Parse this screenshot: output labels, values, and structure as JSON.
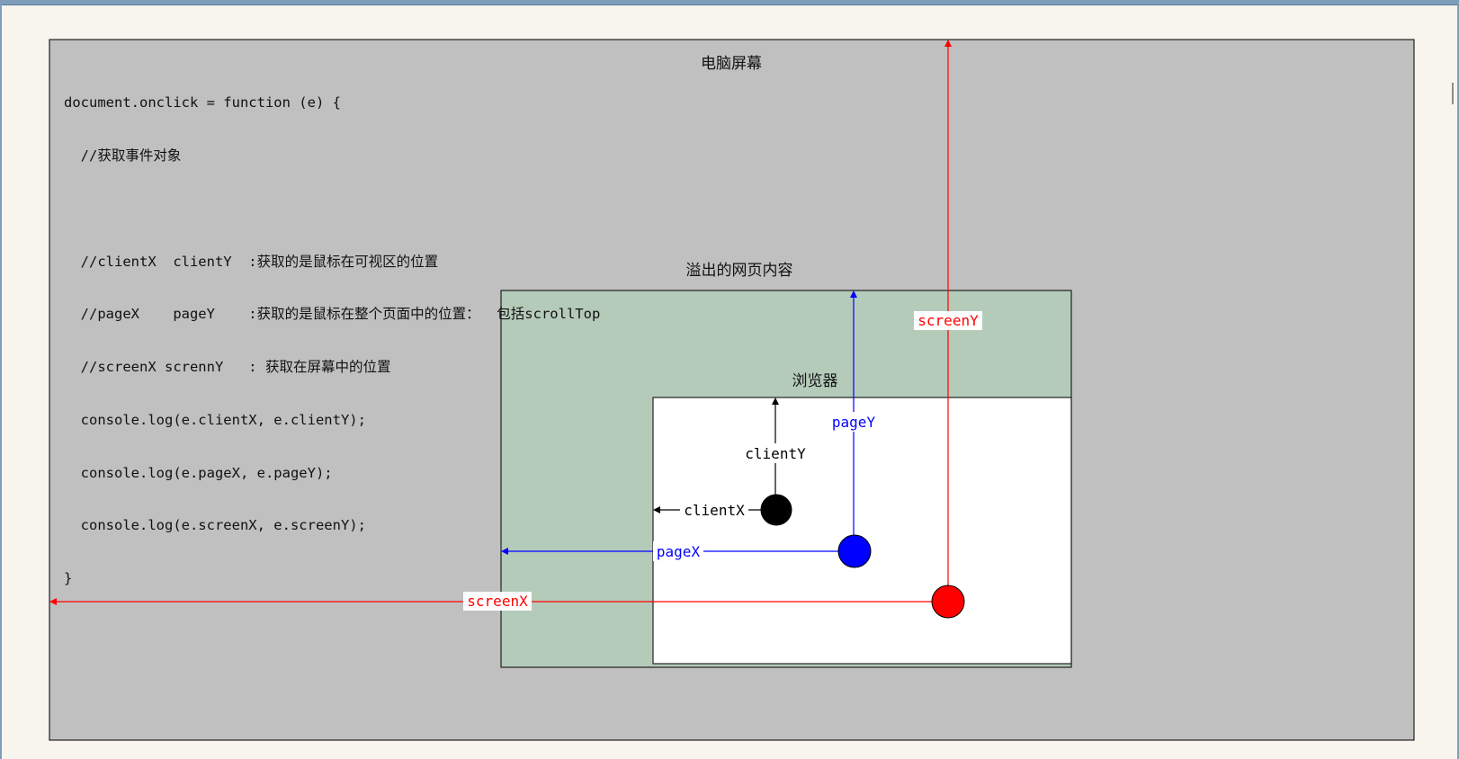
{
  "labels": {
    "screen": "电脑屏幕",
    "overflow": "溢出的网页内容",
    "browser": "浏览器",
    "client_x": "clientX",
    "client_y": "clientY",
    "page_x": "pageX",
    "page_y": "pageY",
    "screen_x": "screenX",
    "screen_y": "screenY"
  },
  "code_lines": [
    "document.onclick = function (e) {",
    "  //获取事件对象",
    "",
    "  //clientX  clientY  :获取的是鼠标在可视区的位置",
    "  //pageX    pageY    :获取的是鼠标在整个页面中的位置：  包括scrollTop",
    "  //screenX scrennY   : 获取在屏幕中的位置",
    "  console.log(e.clientX, e.clientY);",
    "  console.log(e.pageX, e.pageY);",
    "  console.log(e.screenX, e.screenY);",
    "}"
  ],
  "colors": {
    "screen_fill": "#c0c0c0",
    "overflow_fill": "#b5cbba",
    "browser_fill": "#ffffff",
    "client": "#000000",
    "page": "#0000ff",
    "screen": "#ff0000"
  }
}
